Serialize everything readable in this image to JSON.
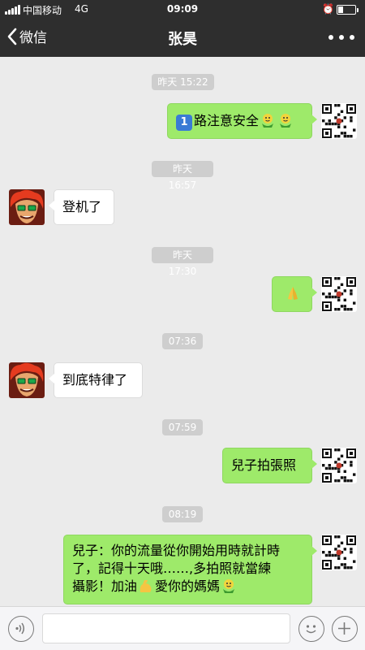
{
  "status": {
    "carrier": "中国移动",
    "network": "4G",
    "time": "09:09",
    "battery_level": 0.3
  },
  "nav": {
    "back_label": "微信",
    "title": "张昊"
  },
  "messages": [
    {
      "kind": "timestamp",
      "text": "昨天 15:22"
    },
    {
      "kind": "outgoing",
      "prefix_badge": "1",
      "text": "路注意安全",
      "emoji": [
        "smiling-bean-emoji",
        "smiling-bean-emoji"
      ]
    },
    {
      "kind": "timestamp",
      "text": "昨天 16:57"
    },
    {
      "kind": "incoming",
      "text": "登机了"
    },
    {
      "kind": "timestamp",
      "text": "昨天 17:30"
    },
    {
      "kind": "outgoing",
      "emoji": [
        "folded-hands-emoji"
      ]
    },
    {
      "kind": "timestamp",
      "text": "07:36"
    },
    {
      "kind": "incoming",
      "text": "到底特律了"
    },
    {
      "kind": "timestamp",
      "text": "07:59"
    },
    {
      "kind": "outgoing",
      "text": "兒子拍張照"
    },
    {
      "kind": "timestamp",
      "text": "08:19"
    },
    {
      "kind": "outgoing",
      "line1": "兒子：你的流量從你開始用時就計時",
      "line2": "了，記得十天哦……,多拍照就當練",
      "line3_a": "攝影！加油",
      "line3_b": "愛你的媽媽",
      "emoji": [
        "flexed-biceps-emoji",
        "smiling-bean-emoji"
      ]
    }
  ],
  "icons": {
    "outgoing_avatar": "qr-code-avatar",
    "incoming_avatar": "red-haired-cartoon-avatar",
    "input_left": "voice-icon",
    "input_right_1": "emoji-icon",
    "input_right_2": "plus-icon"
  },
  "colors": {
    "navbar_bg": "#2e2e2e",
    "chat_bg": "#ebebeb",
    "outgoing_bubble": "#9eea6a",
    "incoming_bubble": "#ffffff",
    "timestamp_bg": "#cecece"
  }
}
